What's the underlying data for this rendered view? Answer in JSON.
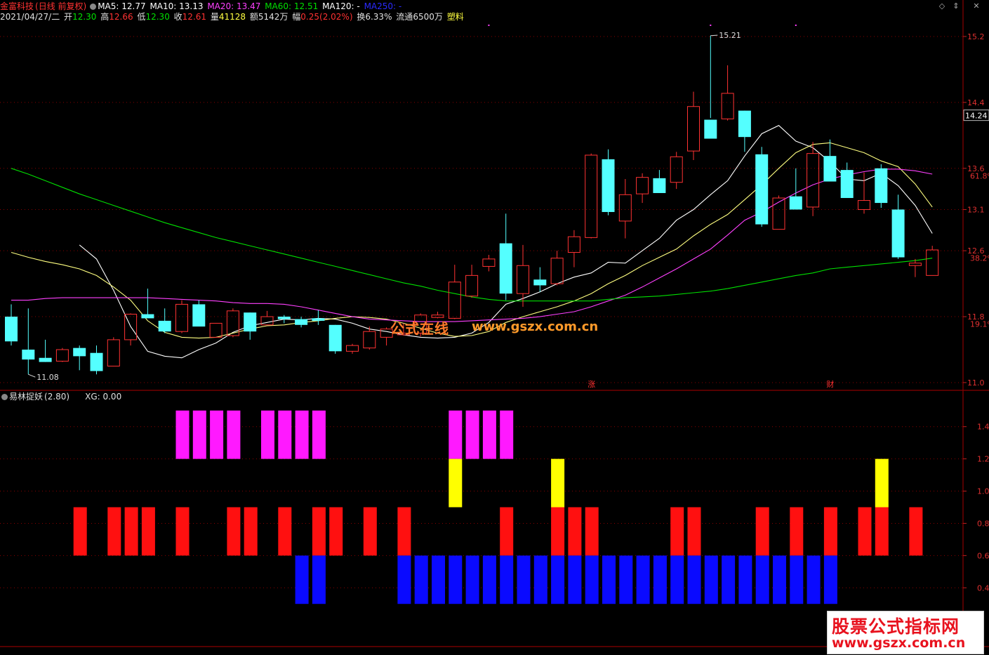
{
  "header": {
    "stock_name": "金富科技",
    "period_label": "(日线 前复权)",
    "ma5_label": "MA5: 12.77",
    "ma10_label": "MA10: 13.13",
    "ma20_label": "MA20: 13.47",
    "ma60_label": "MA60: 12.51",
    "ma120_label": "MA120: -",
    "ma250_label": "MA250: -",
    "date_label": "2021/04/27/二",
    "open_label": "开",
    "open_value": "12.30",
    "high_label": "高",
    "high_value": "12.66",
    "low_label": "低",
    "low_value": "12.30",
    "close_label": "收",
    "close_value": "12.61",
    "volume_label": "量",
    "volume_value": "41128",
    "amount_label": "额",
    "amount_value": "5142万",
    "range_label": "幅",
    "range_value": "0.25(2.02%)",
    "turnover_label": "换",
    "turnover_value": "6.33%",
    "float_label": "流通",
    "float_value": "6500万",
    "sector": "塑料"
  },
  "indicator_header": {
    "name": "易林捉妖",
    "param": "(2.80)",
    "xg_label": "XG: 0.00"
  },
  "colors": {
    "up": "#ff3232",
    "down": "#54ffff",
    "ma5": "#ffffff",
    "ma10": "#ffff80",
    "ma20": "#ff40ff",
    "ma60": "#00e000",
    "ma250": "#0000ff",
    "grid": "#8a0000",
    "magenta": "#ff19ff",
    "yellow": "#ffff00",
    "red": "#ff1010",
    "blue": "#0a0aff"
  },
  "watermark": {
    "cn": "公式在线",
    "url": "www.gszx.com.cn"
  },
  "badge": {
    "line1": "股票公式指标网",
    "line2": "www.gszx.com.cn"
  },
  "chart_data": [
    {
      "type": "candlestick",
      "title": "金富科技(日线 前复权)",
      "ylim": [
        10.94,
        15.37
      ],
      "price_ticks": [
        "15.2",
        "14.4",
        "13.6",
        "13.1",
        "12.6",
        "11.8",
        "11.0"
      ],
      "price_tick_values": [
        15.2,
        14.4,
        13.6,
        13.1,
        12.6,
        11.8,
        11.0
      ],
      "pct_ticks": [
        "61.8%",
        "38.2%",
        "19.1%"
      ],
      "pct_tick_values": [
        13.51,
        12.51,
        11.71
      ],
      "current_price_label": "14.24",
      "current_price": 14.24,
      "high_mark": "15.21",
      "low_mark": "11.08",
      "event_marks": [
        {
          "label": "涨",
          "index": 34
        },
        {
          "label": "财",
          "index": 48
        }
      ],
      "candles": [
        {
          "o": 11.8,
          "h": 11.95,
          "l": 11.45,
          "c": 11.5
        },
        {
          "o": 11.4,
          "h": 11.9,
          "l": 11.1,
          "c": 11.28
        },
        {
          "o": 11.3,
          "h": 11.52,
          "l": 11.25,
          "c": 11.25
        },
        {
          "o": 11.26,
          "h": 11.42,
          "l": 11.25,
          "c": 11.4
        },
        {
          "o": 11.42,
          "h": 11.45,
          "l": 11.15,
          "c": 11.32
        },
        {
          "o": 11.36,
          "h": 11.45,
          "l": 11.1,
          "c": 11.14
        },
        {
          "o": 11.2,
          "h": 11.55,
          "l": 11.2,
          "c": 11.52
        },
        {
          "o": 11.52,
          "h": 11.84,
          "l": 11.45,
          "c": 11.83
        },
        {
          "o": 11.83,
          "h": 12.14,
          "l": 11.82,
          "c": 11.78
        },
        {
          "o": 11.75,
          "h": 11.9,
          "l": 11.6,
          "c": 11.62
        },
        {
          "o": 11.62,
          "h": 12.0,
          "l": 11.6,
          "c": 11.95
        },
        {
          "o": 11.95,
          "h": 12.0,
          "l": 11.7,
          "c": 11.68
        },
        {
          "o": 11.55,
          "h": 11.72,
          "l": 11.55,
          "c": 11.72
        },
        {
          "o": 11.57,
          "h": 11.9,
          "l": 11.55,
          "c": 11.87
        },
        {
          "o": 11.85,
          "h": 11.85,
          "l": 11.52,
          "c": 11.62
        },
        {
          "o": 11.7,
          "h": 11.87,
          "l": 11.7,
          "c": 11.8
        },
        {
          "o": 11.8,
          "h": 11.82,
          "l": 11.72,
          "c": 11.77
        },
        {
          "o": 11.77,
          "h": 11.8,
          "l": 11.67,
          "c": 11.7
        },
        {
          "o": 11.78,
          "h": 11.88,
          "l": 11.7,
          "c": 11.75
        },
        {
          "o": 11.7,
          "h": 11.7,
          "l": 11.35,
          "c": 11.38
        },
        {
          "o": 11.38,
          "h": 11.47,
          "l": 11.35,
          "c": 11.45
        },
        {
          "o": 11.42,
          "h": 11.68,
          "l": 11.4,
          "c": 11.62
        },
        {
          "o": 11.55,
          "h": 11.67,
          "l": 11.45,
          "c": 11.65
        },
        {
          "o": 11.58,
          "h": 11.72,
          "l": 11.57,
          "c": 11.6
        },
        {
          "o": 11.6,
          "h": 11.84,
          "l": 11.56,
          "c": 11.82
        },
        {
          "o": 11.79,
          "h": 11.86,
          "l": 11.78,
          "c": 11.82
        },
        {
          "o": 11.78,
          "h": 12.43,
          "l": 11.77,
          "c": 12.22
        },
        {
          "o": 12.05,
          "h": 12.43,
          "l": 12.03,
          "c": 12.3
        },
        {
          "o": 12.41,
          "h": 12.55,
          "l": 12.35,
          "c": 12.5
        },
        {
          "o": 12.69,
          "h": 13.05,
          "l": 12.0,
          "c": 12.08
        },
        {
          "o": 12.08,
          "h": 12.67,
          "l": 11.92,
          "c": 12.42
        },
        {
          "o": 12.25,
          "h": 12.4,
          "l": 12.1,
          "c": 12.18
        },
        {
          "o": 12.2,
          "h": 12.6,
          "l": 12.18,
          "c": 12.51
        },
        {
          "o": 12.58,
          "h": 12.85,
          "l": 12.4,
          "c": 12.77
        },
        {
          "o": 12.76,
          "h": 13.78,
          "l": 12.75,
          "c": 13.76
        },
        {
          "o": 13.71,
          "h": 13.83,
          "l": 13.03,
          "c": 13.07
        },
        {
          "o": 12.96,
          "h": 13.47,
          "l": 12.75,
          "c": 13.28
        },
        {
          "o": 13.29,
          "h": 13.54,
          "l": 13.18,
          "c": 13.49
        },
        {
          "o": 13.48,
          "h": 13.58,
          "l": 13.3,
          "c": 13.3
        },
        {
          "o": 13.43,
          "h": 13.8,
          "l": 13.35,
          "c": 13.74
        },
        {
          "o": 13.81,
          "h": 14.53,
          "l": 13.7,
          "c": 14.35
        },
        {
          "o": 14.19,
          "h": 15.21,
          "l": 14.21,
          "c": 13.96
        },
        {
          "o": 14.2,
          "h": 14.85,
          "l": 14.18,
          "c": 14.51
        },
        {
          "o": 14.3,
          "h": 14.3,
          "l": 13.8,
          "c": 13.98
        },
        {
          "o": 13.77,
          "h": 13.86,
          "l": 12.89,
          "c": 12.92
        },
        {
          "o": 12.86,
          "h": 13.27,
          "l": 12.86,
          "c": 13.24
        },
        {
          "o": 13.26,
          "h": 13.6,
          "l": 13.1,
          "c": 13.1
        },
        {
          "o": 13.13,
          "h": 13.92,
          "l": 13.02,
          "c": 13.78
        },
        {
          "o": 13.75,
          "h": 13.95,
          "l": 13.45,
          "c": 13.44
        },
        {
          "o": 13.58,
          "h": 13.67,
          "l": 13.24,
          "c": 13.24
        },
        {
          "o": 13.1,
          "h": 13.55,
          "l": 13.05,
          "c": 13.21
        },
        {
          "o": 13.6,
          "h": 13.65,
          "l": 13.12,
          "c": 13.18
        },
        {
          "o": 13.1,
          "h": 13.28,
          "l": 12.5,
          "c": 12.52
        },
        {
          "o": 12.42,
          "h": 12.5,
          "l": 12.28,
          "c": 12.45
        },
        {
          "o": 12.3,
          "h": 12.66,
          "l": 12.3,
          "c": 12.61
        }
      ],
      "series": [
        {
          "name": "MA5",
          "values": [
            null,
            null,
            null,
            null,
            12.67,
            12.5,
            12.12,
            11.68,
            11.38,
            11.32,
            11.3,
            11.4,
            11.48,
            11.61,
            11.69,
            11.73,
            11.77,
            11.76,
            11.78,
            11.77,
            11.72,
            11.65,
            11.62,
            11.58,
            11.55,
            11.54,
            11.55,
            11.6,
            11.73,
            11.95,
            12.02,
            12.1,
            12.2,
            12.28,
            12.33,
            12.46,
            12.45,
            12.6,
            12.75,
            12.97,
            13.1,
            13.28,
            13.45,
            13.75,
            14.02,
            14.12,
            13.93,
            13.85,
            13.68,
            13.47,
            13.45,
            13.54,
            13.39,
            13.15,
            12.81
          ]
        },
        {
          "name": "MA10",
          "values": [
            12.58,
            12.52,
            12.47,
            12.43,
            12.38,
            12.3,
            12.16,
            12.0,
            11.75,
            11.61,
            11.55,
            11.54,
            11.55,
            11.6,
            11.65,
            11.69,
            11.7,
            11.73,
            11.75,
            11.78,
            11.8,
            11.79,
            11.77,
            11.72,
            11.66,
            11.6,
            11.56,
            11.57,
            11.62,
            11.73,
            11.8,
            11.86,
            11.92,
            11.99,
            12.08,
            12.2,
            12.3,
            12.42,
            12.52,
            12.62,
            12.78,
            12.92,
            13.04,
            13.22,
            13.4,
            13.6,
            13.79,
            13.89,
            13.91,
            13.85,
            13.79,
            13.69,
            13.62,
            13.41,
            13.13
          ]
        },
        {
          "name": "MA20",
          "values": [
            12.0,
            12.0,
            12.02,
            12.03,
            12.03,
            12.03,
            12.03,
            12.03,
            12.03,
            12.02,
            12.01,
            12.0,
            11.99,
            11.97,
            11.96,
            11.96,
            11.95,
            11.92,
            11.88,
            11.84,
            11.8,
            11.77,
            11.76,
            11.75,
            11.74,
            11.74,
            11.74,
            11.75,
            11.76,
            11.77,
            11.78,
            11.8,
            11.83,
            11.86,
            11.92,
            11.99,
            12.06,
            12.16,
            12.27,
            12.38,
            12.5,
            12.62,
            12.79,
            12.97,
            13.07,
            13.19,
            13.3,
            13.4,
            13.47,
            13.52,
            13.56,
            13.59,
            13.59,
            13.57,
            13.53
          ]
        },
        {
          "name": "MA60",
          "values": [
            13.6,
            13.53,
            13.45,
            13.37,
            13.29,
            13.22,
            13.15,
            13.08,
            13.01,
            12.94,
            12.88,
            12.82,
            12.76,
            12.71,
            12.66,
            12.61,
            12.56,
            12.51,
            12.46,
            12.41,
            12.36,
            12.31,
            12.26,
            12.21,
            12.17,
            12.12,
            12.08,
            12.04,
            12.01,
            11.99,
            11.99,
            11.99,
            11.99,
            11.99,
            11.99,
            12.01,
            12.03,
            12.04,
            12.05,
            12.07,
            12.09,
            12.11,
            12.14,
            12.18,
            12.22,
            12.26,
            12.3,
            12.33,
            12.38,
            12.4,
            12.42,
            12.44,
            12.46,
            12.48,
            12.51
          ]
        }
      ]
    },
    {
      "type": "bar",
      "title": "易林捉妖(2.80)",
      "ylim": [
        0.24,
        1.56
      ],
      "y_ticks": [
        "1.4",
        "1.2",
        "1.0",
        "0.8",
        "0.6",
        "0.4"
      ],
      "y_tick_values": [
        1.4,
        1.2,
        1.0,
        0.8,
        0.6,
        0.4
      ],
      "series": [
        {
          "name": "magenta",
          "color": "#ff19ff",
          "range": [
            1.2,
            1.5
          ],
          "indices": [
            10,
            11,
            12,
            13,
            15,
            16,
            17,
            18,
            26,
            27,
            28,
            29
          ]
        },
        {
          "name": "yellow",
          "color": "#ffff00",
          "range": [
            0.9,
            1.2
          ],
          "indices": [
            26,
            32,
            51
          ]
        },
        {
          "name": "red",
          "color": "#ff1010",
          "range": [
            0.6,
            0.9
          ],
          "indices": [
            4,
            6,
            7,
            8,
            10,
            13,
            14,
            16,
            18,
            19,
            21,
            23,
            29,
            32,
            33,
            34,
            39,
            40,
            44,
            46,
            48,
            50,
            51,
            53
          ]
        },
        {
          "name": "blue",
          "color": "#0a0aff",
          "range": [
            0.3,
            0.6
          ],
          "indices": [
            17,
            18,
            23,
            24,
            25,
            26,
            27,
            28,
            29,
            30,
            31,
            32,
            33,
            34,
            35,
            36,
            37,
            38,
            39,
            40,
            41,
            42,
            43,
            44,
            45,
            46,
            47,
            48
          ]
        }
      ]
    }
  ]
}
